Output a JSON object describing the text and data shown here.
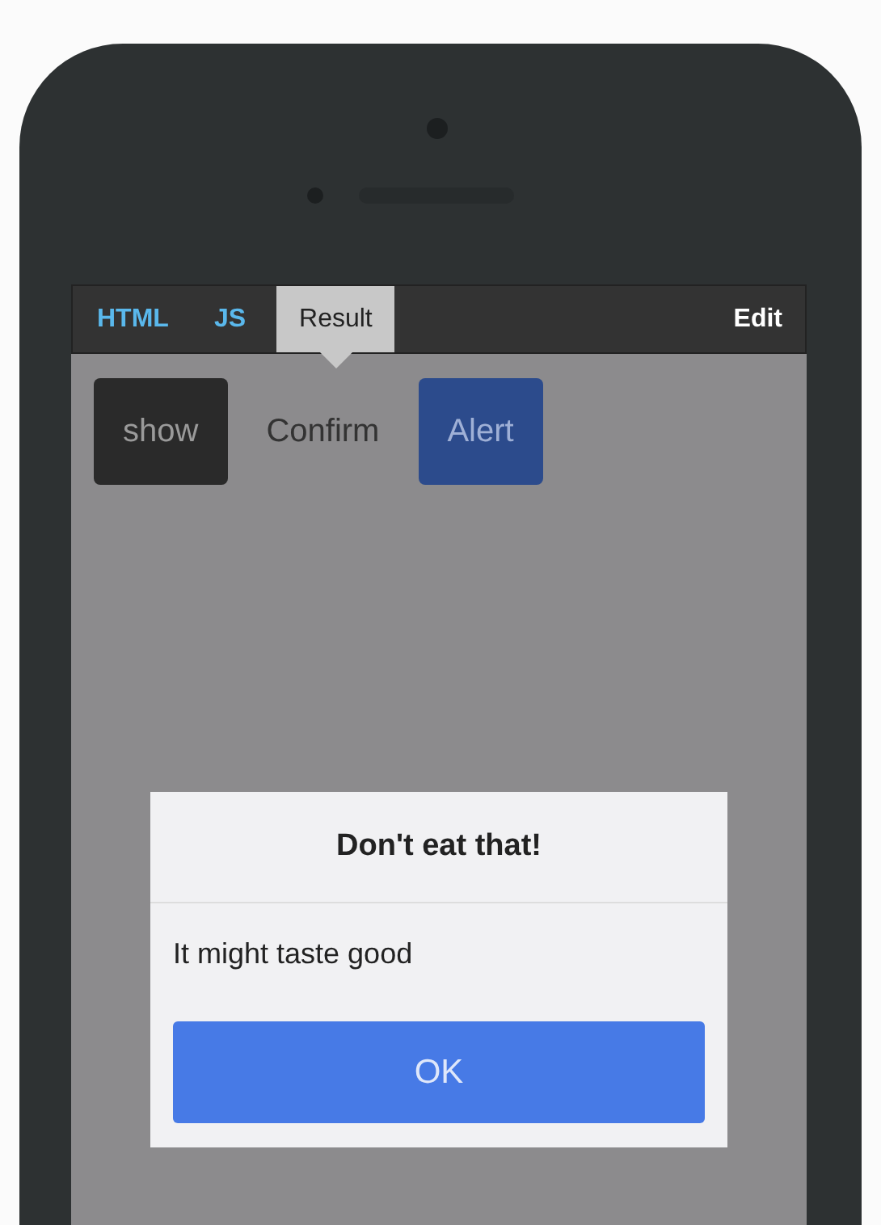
{
  "tabs": [
    {
      "label": "HTML",
      "selected": false
    },
    {
      "label": "JS",
      "selected": false
    },
    {
      "label": "Result",
      "selected": true
    }
  ],
  "edit_link": "Edit",
  "buttons": [
    {
      "label": "show",
      "kind": "dark"
    },
    {
      "label": "Confirm",
      "kind": "plain"
    },
    {
      "label": "Alert",
      "kind": "primary"
    }
  ],
  "dialog": {
    "title": "Don't eat that!",
    "message": "It might taste good",
    "button": "OK"
  }
}
